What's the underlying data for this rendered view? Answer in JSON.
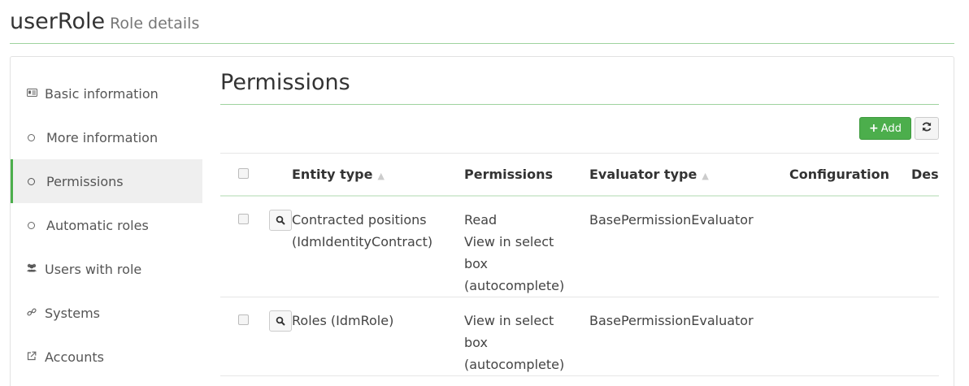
{
  "header": {
    "title": "userRole",
    "subtitle": "Role details"
  },
  "sidebar": {
    "items": [
      {
        "label": "Basic information",
        "icon": "id-card-icon"
      },
      {
        "label": "More information",
        "icon": "circle-icon"
      },
      {
        "label": "Permissions",
        "icon": "circle-icon",
        "active": true
      },
      {
        "label": "Automatic roles",
        "icon": "circle-icon"
      },
      {
        "label": "Users with role",
        "icon": "users-icon"
      },
      {
        "label": "Systems",
        "icon": "link-icon"
      },
      {
        "label": "Accounts",
        "icon": "external-link-icon"
      }
    ]
  },
  "main": {
    "title": "Permissions",
    "toolbar": {
      "add_label": "Add",
      "add_color": "#4cae4c"
    },
    "table": {
      "columns": [
        "Entity type",
        "Permissions",
        "Evaluator type",
        "Configuration",
        "Des"
      ],
      "rows": [
        {
          "entity_type": [
            "Contracted positions",
            "(IdmIdentityContract)"
          ],
          "permissions": [
            "Read",
            "View in select",
            "box",
            "(autocomplete)"
          ],
          "evaluator_type": "BasePermissionEvaluator",
          "configuration": ""
        },
        {
          "entity_type": [
            "Roles (IdmRole)"
          ],
          "permissions": [
            "View in select",
            "box",
            "(autocomplete)"
          ],
          "evaluator_type": "BasePermissionEvaluator",
          "configuration": ""
        }
      ]
    }
  }
}
